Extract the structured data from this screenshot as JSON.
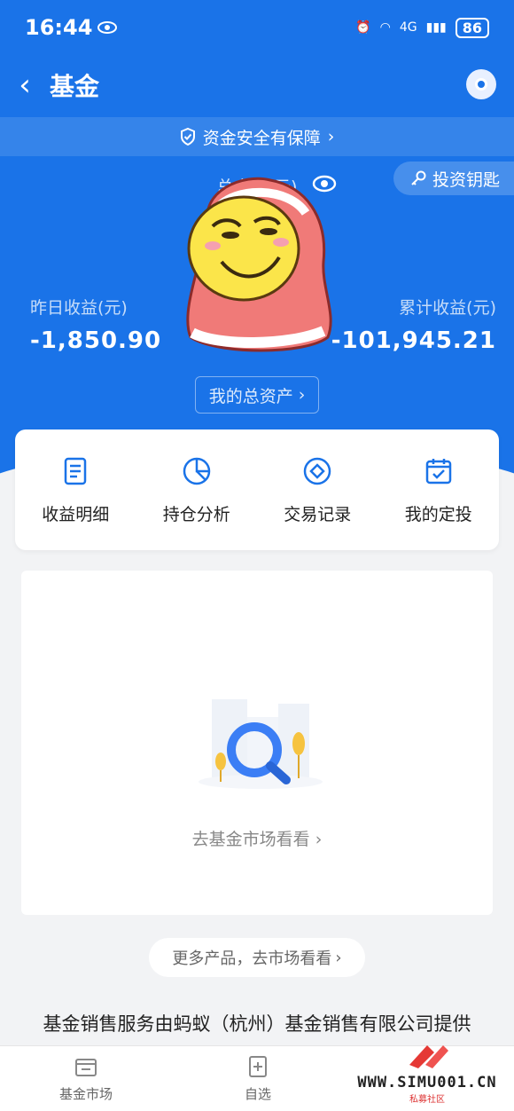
{
  "status_bar": {
    "time": "16:44",
    "network": "4G",
    "battery": "86"
  },
  "nav": {
    "title": "基金"
  },
  "safety_banner": {
    "text": "资金安全有保障"
  },
  "key_button": {
    "label": "投资钥匙"
  },
  "summary": {
    "total_label": "总金额(元)",
    "yesterday_label": "昨日收益(元)",
    "yesterday_value": "-1,850.90",
    "cumulative_label": "累计收益(元)",
    "cumulative_value": "-101,945.21",
    "assets_button": "我的总资产"
  },
  "quick_actions": [
    {
      "label": "收益明细",
      "icon": "document-icon"
    },
    {
      "label": "持仓分析",
      "icon": "pie-chart-icon"
    },
    {
      "label": "交易记录",
      "icon": "record-icon"
    },
    {
      "label": "我的定投",
      "icon": "calendar-check-icon"
    }
  ],
  "empty_state": {
    "link": "去基金市场看看"
  },
  "more_products": {
    "label": "更多产品，去市场看看"
  },
  "footer_note": "基金销售服务由蚂蚁（杭州）基金销售有限公司提供",
  "tabbar": {
    "items": [
      {
        "label": "基金市场",
        "icon": "market-icon"
      },
      {
        "label": "自选",
        "icon": "add-favorite-icon"
      }
    ]
  },
  "watermark": {
    "text": "WWW.SIMU001.CN",
    "sub": "私募社区"
  },
  "colors": {
    "primary": "#1a73e8",
    "background": "#f2f3f5",
    "card": "#ffffff"
  }
}
